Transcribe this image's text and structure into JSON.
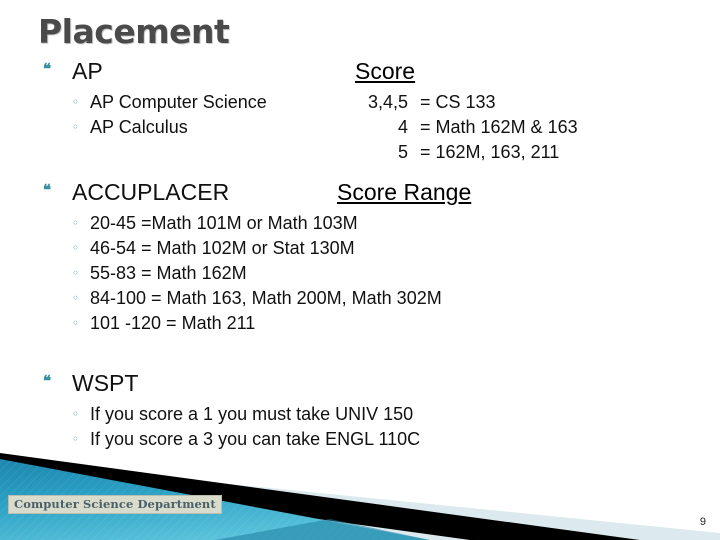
{
  "slide": {
    "title": "Placement",
    "page_number": "9",
    "department_badge": "Computer Science Department",
    "bullet_glyph_level1": "❝",
    "bullet_glyph_level2": "◦",
    "accent_color": "#3c8ea3",
    "title_color": "#4a4a4a",
    "footer_teal": "#2596bd",
    "footer_black": "#000000",
    "footer_light": "#dce9ef"
  },
  "sections": [
    {
      "id": "ap",
      "label": "AP",
      "column_header": "Score",
      "rows": [
        {
          "name": "AP Computer Science",
          "score": "3,4,5",
          "result": "= CS 133"
        },
        {
          "name": "AP Calculus",
          "score": "4",
          "result": "= Math 162M & 163"
        },
        {
          "name": "",
          "score": "5",
          "result": "= 162M, 163, 211"
        }
      ]
    },
    {
      "id": "accuplacer",
      "label": "ACCUPLACER",
      "column_header": "Score Range",
      "rows": [
        {
          "text": "20-45 =Math 101M or Math 103M"
        },
        {
          "text": "46-54 = Math 102M or Stat 130M"
        },
        {
          "text": "55-83 = Math 162M"
        },
        {
          "text": "84-100 = Math 163, Math 200M, Math 302M"
        },
        {
          "text": "101 -120 = Math 211"
        }
      ]
    },
    {
      "id": "wspt",
      "label": "WSPT",
      "column_header": "",
      "rows": [
        {
          "text": "If you score a 1 you must take UNIV 150"
        },
        {
          "text": "If you score a 3 you can take ENGL 110C"
        }
      ]
    }
  ]
}
